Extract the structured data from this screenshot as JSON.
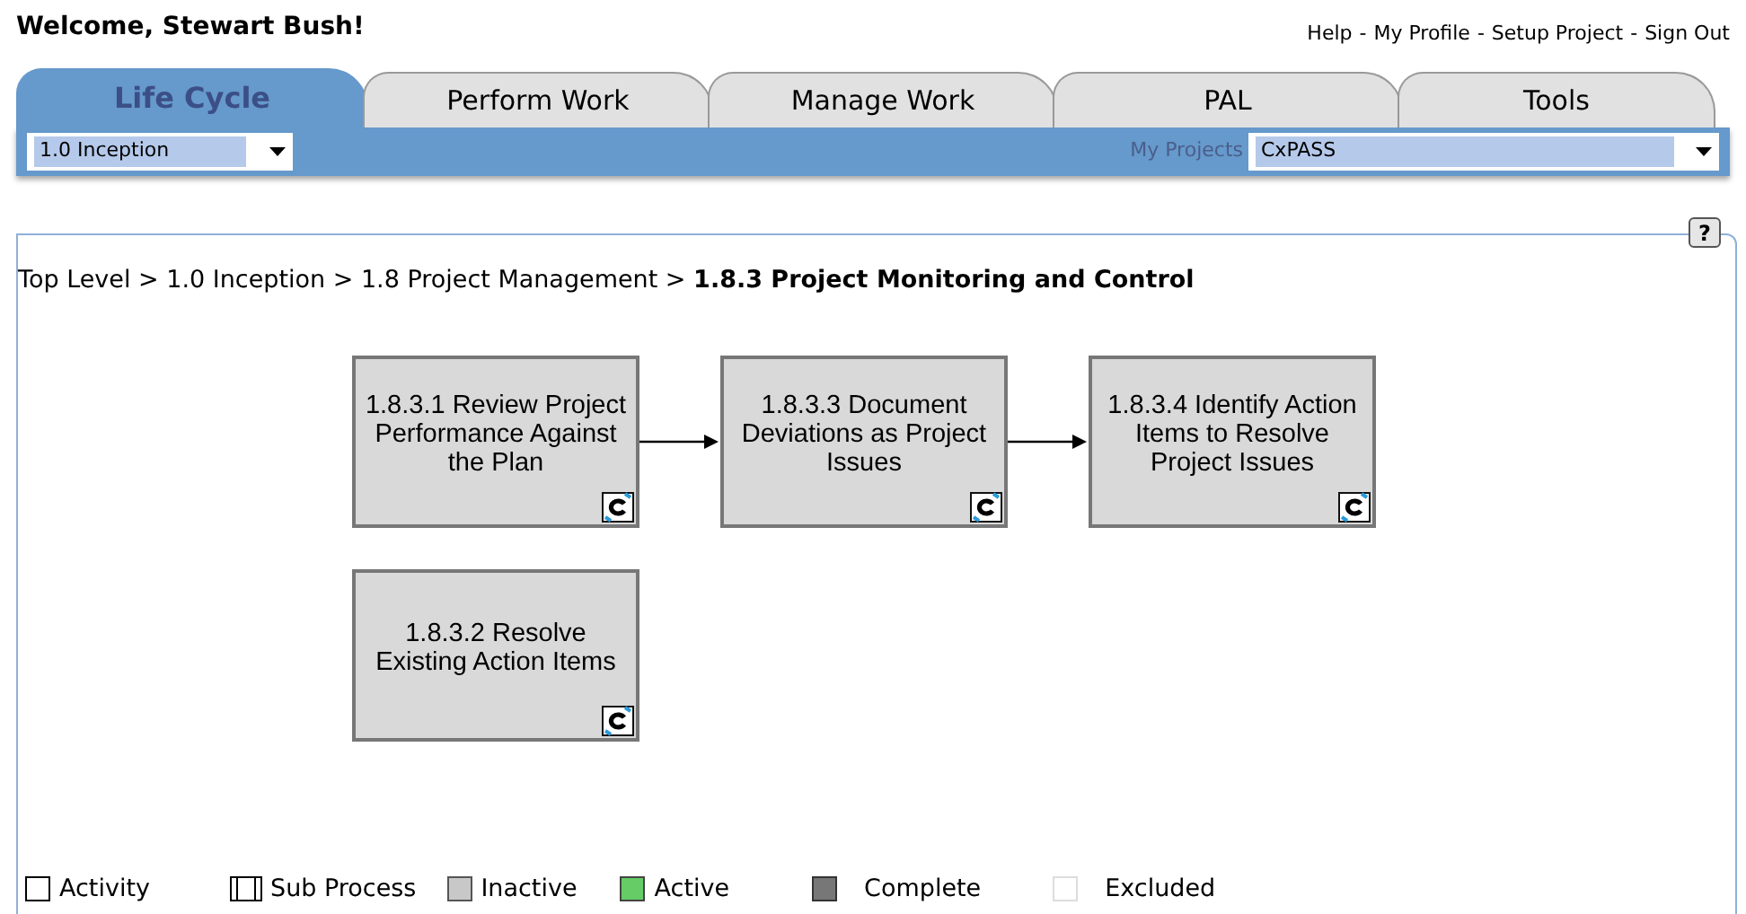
{
  "welcome": "Welcome, Stewart Bush!",
  "top_links": [
    "Help",
    "My Profile",
    "Setup Project",
    "Sign Out"
  ],
  "top_link_separator": "-",
  "tabs": [
    {
      "label": "Life Cycle",
      "selected": true
    },
    {
      "label": "Perform Work",
      "selected": false
    },
    {
      "label": "Manage Work",
      "selected": false
    },
    {
      "label": "PAL",
      "selected": false
    },
    {
      "label": "Tools",
      "selected": false
    }
  ],
  "phase_select": {
    "value": "1.0 Inception"
  },
  "projects": {
    "label": "My Projects",
    "value": "CxPASS"
  },
  "help_button": "?",
  "breadcrumb": [
    "Top Level",
    "1.0 Inception",
    "1.8 Project Management"
  ],
  "breadcrumb_separator": ">",
  "breadcrumb_current": "1.8.3 Project Monitoring and Control",
  "diagram_rows": [
    [
      {
        "label": "1.8.3.1 Review Project Performance Against the Plan",
        "inactive": true
      },
      {
        "label": "1.8.3.3 Document Deviations as Project Issues",
        "inactive": true
      },
      {
        "label": "1.8.3.4 Identify Action Items to Resolve Project Issues",
        "inactive": true
      }
    ],
    [
      {
        "label": "1.8.3.2 Resolve Existing Action Items",
        "inactive": true
      }
    ]
  ],
  "legend": [
    {
      "kind": "activity",
      "label": "Activity"
    },
    {
      "kind": "subprocess",
      "label": "Sub Process"
    },
    {
      "kind": "inactive",
      "label": "Inactive"
    },
    {
      "kind": "active",
      "label": "Active"
    },
    {
      "kind": "complete",
      "label": "Complete"
    },
    {
      "kind": "excluded",
      "label": "Excluded"
    }
  ]
}
